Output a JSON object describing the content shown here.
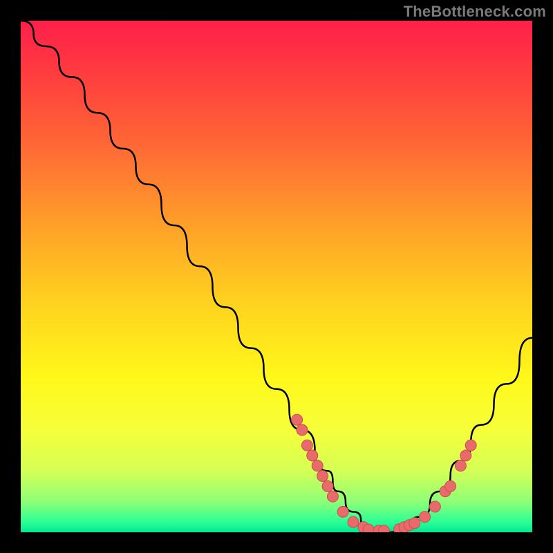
{
  "watermark": "TheBottleneck.com",
  "chart_data": {
    "type": "line",
    "title": "",
    "xlabel": "",
    "ylabel": "",
    "xlim": [
      0,
      100
    ],
    "ylim": [
      0,
      100
    ],
    "grid": false,
    "legend": false,
    "series": [
      {
        "name": "bottleneck-curve",
        "x": [
          0,
          5,
          10,
          15,
          20,
          25,
          30,
          35,
          40,
          45,
          50,
          55,
          60,
          62,
          65,
          68,
          70,
          72,
          75,
          78,
          82,
          86,
          90,
          95,
          100
        ],
        "y": [
          100,
          95,
          89,
          82,
          75,
          68,
          60,
          52,
          44,
          36,
          28,
          20,
          12,
          8,
          4,
          1,
          0,
          0,
          1,
          3,
          8,
          14,
          21,
          29,
          38
        ]
      }
    ],
    "markers": [
      {
        "name": "point-a",
        "x": 54,
        "y": 22
      },
      {
        "name": "point-b",
        "x": 55,
        "y": 20
      },
      {
        "name": "point-c",
        "x": 56,
        "y": 17
      },
      {
        "name": "point-d",
        "x": 57,
        "y": 15
      },
      {
        "name": "point-e",
        "x": 58,
        "y": 13
      },
      {
        "name": "point-f",
        "x": 59,
        "y": 11
      },
      {
        "name": "point-g",
        "x": 60,
        "y": 9
      },
      {
        "name": "point-h",
        "x": 61,
        "y": 7
      },
      {
        "name": "point-i",
        "x": 63,
        "y": 4
      },
      {
        "name": "point-j",
        "x": 65,
        "y": 2
      },
      {
        "name": "point-k",
        "x": 67,
        "y": 1
      },
      {
        "name": "point-l",
        "x": 68,
        "y": 0.5
      },
      {
        "name": "point-m",
        "x": 70,
        "y": 0.3
      },
      {
        "name": "point-n",
        "x": 71,
        "y": 0.3
      },
      {
        "name": "point-o",
        "x": 74,
        "y": 0.6
      },
      {
        "name": "point-p",
        "x": 75,
        "y": 1
      },
      {
        "name": "point-q",
        "x": 76,
        "y": 1.4
      },
      {
        "name": "point-r",
        "x": 77,
        "y": 1.8
      },
      {
        "name": "point-s",
        "x": 79,
        "y": 3
      },
      {
        "name": "point-t",
        "x": 81,
        "y": 5
      },
      {
        "name": "point-u",
        "x": 83,
        "y": 8
      },
      {
        "name": "point-v",
        "x": 84,
        "y": 9
      },
      {
        "name": "point-w",
        "x": 86,
        "y": 13
      },
      {
        "name": "point-x",
        "x": 87,
        "y": 15
      },
      {
        "name": "point-y",
        "x": 88,
        "y": 17
      }
    ],
    "colors": {
      "curve": "#000000",
      "marker_fill": "#e86a6a",
      "marker_stroke": "#c94f4f"
    }
  }
}
